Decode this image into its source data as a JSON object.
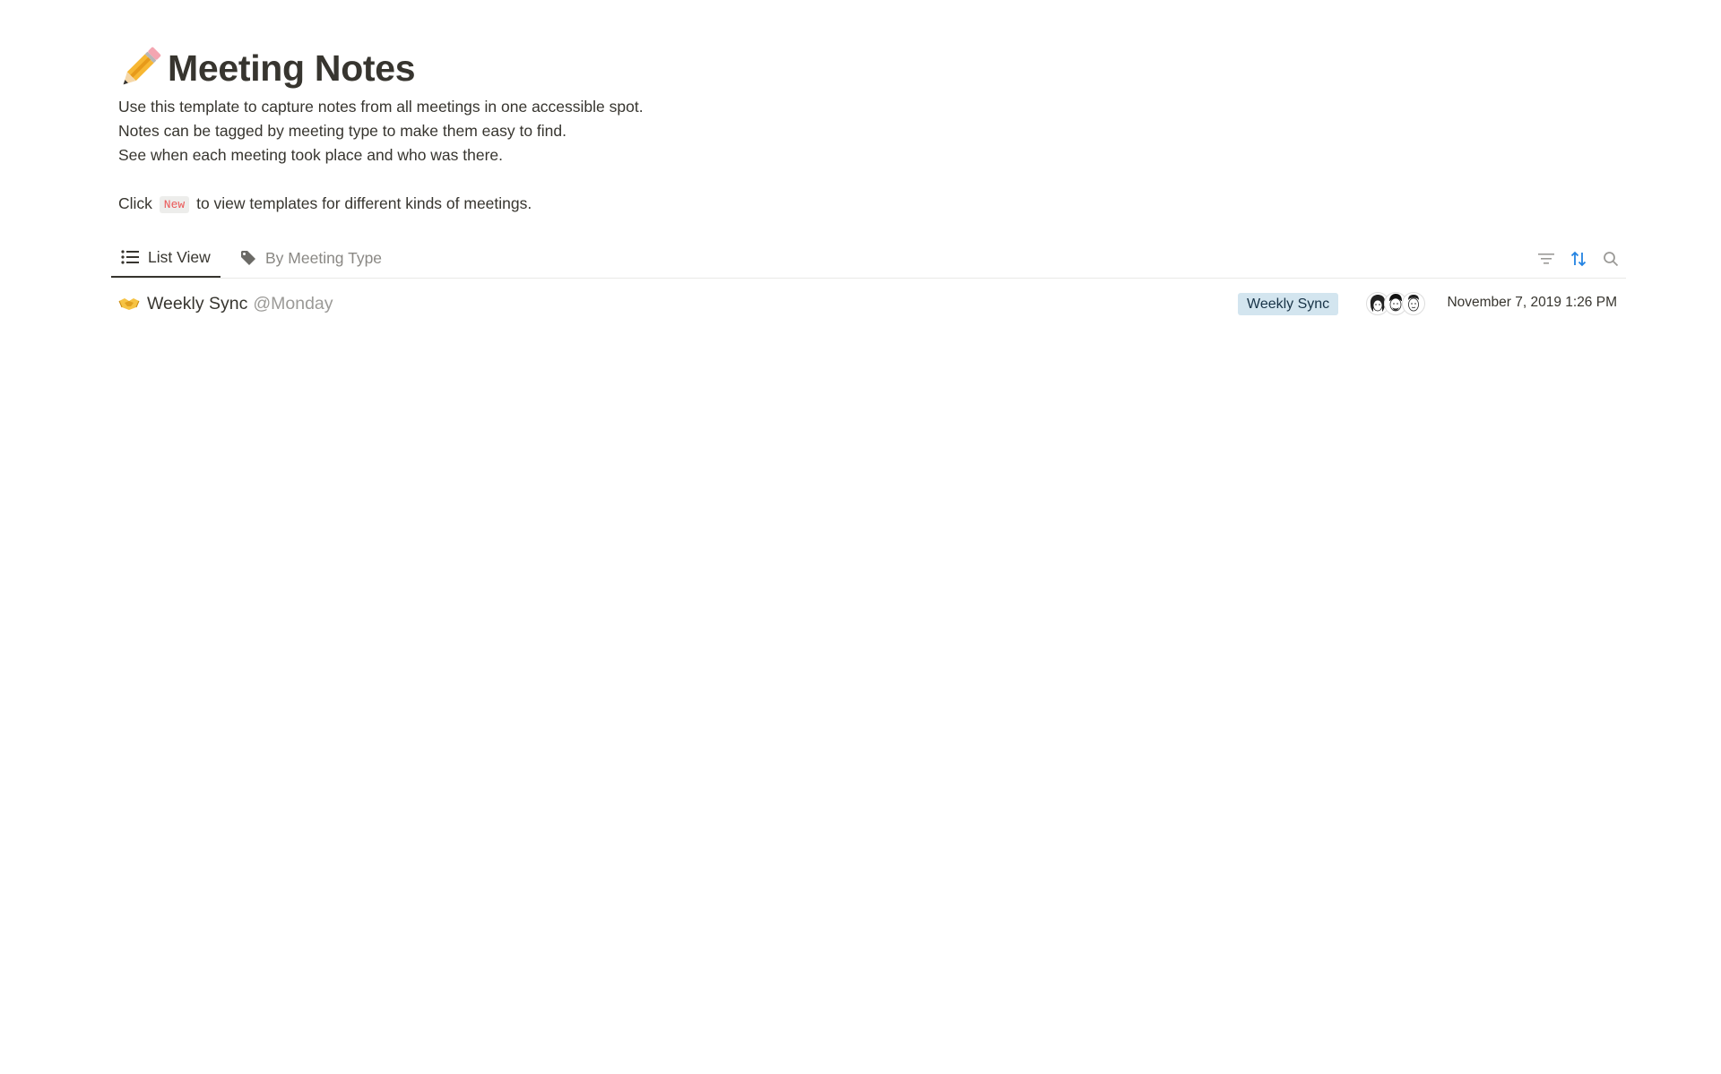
{
  "page": {
    "title": "Meeting Notes",
    "title_icon": "pencil-icon",
    "description": [
      "Use this template to capture notes from all meetings in one accessible spot.",
      "Notes can be tagged by meeting type to make them easy to find.",
      "See when each meeting took place and who was there."
    ],
    "hint_before": "Click",
    "hint_code": "New",
    "hint_after": "to view templates for different kinds of meetings."
  },
  "tabs": [
    {
      "label": "List View",
      "icon": "list-icon",
      "active": true
    },
    {
      "label": "By Meeting Type",
      "icon": "tag-icon",
      "active": false
    }
  ],
  "toolbar": {
    "icons": [
      "filter-icon",
      "sort-icon",
      "search-icon"
    ],
    "sort_color": "#2383e2"
  },
  "rows": [
    {
      "icon": "handshake-icon",
      "title": "Weekly Sync",
      "mention": "@Monday",
      "tag": "Weekly Sync",
      "tag_color": "#d3e5ef",
      "attendee_count": 3,
      "date": "November 7, 2019 1:26 PM"
    }
  ]
}
